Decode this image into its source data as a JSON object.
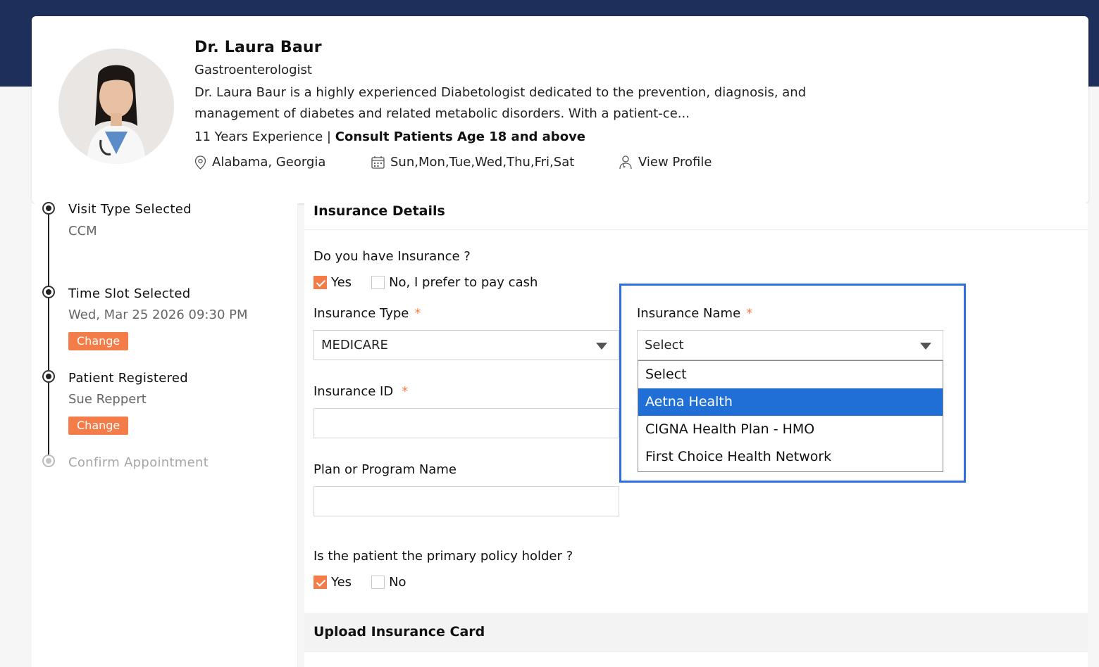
{
  "doctor": {
    "name": "Dr. Laura Baur",
    "specialty": "Gastroenterologist",
    "description": "Dr. Laura Baur is a highly experienced Diabetologist dedicated to the prevention, diagnosis, and management of diabetes and related metabolic disorders. With a patient-ce...",
    "experience": "11 Years Experience |",
    "consult": "Consult Patients Age 18 and above",
    "location": "Alabama, Georgia",
    "days": "Sun,Mon,Tue,Wed,Thu,Fri,Sat",
    "view_profile": "View Profile"
  },
  "timeline": [
    {
      "title": "Visit Type Selected",
      "sub": "CCM"
    },
    {
      "title": "Time Slot Selected",
      "sub": "Wed, Mar 25 2026 09:30 PM",
      "action": "Change"
    },
    {
      "title": "Patient Registered",
      "sub": "Sue Reppert",
      "action": "Change"
    },
    {
      "title": "Confirm Appointment"
    }
  ],
  "insurance": {
    "section_title": "Insurance Details",
    "question": "Do you have Insurance ?",
    "yes_label": "Yes",
    "no_label": "No, I prefer to pay cash",
    "type_label": "Insurance Type",
    "type_value": "MEDICARE",
    "name_label": "Insurance Name",
    "name_value": "Select",
    "id_label": "Insurance ID",
    "plan_label": "Plan or Program Name",
    "primary_question": "Is the patient the primary policy holder ?",
    "primary_yes": "Yes",
    "primary_no": "No",
    "required_mark": "*",
    "options": [
      "Select",
      "Aetna Health",
      "CIGNA Health Plan - HMO",
      "First Choice Health Network"
    ]
  },
  "upload": {
    "section_title": "Upload Insurance Card"
  },
  "colors": {
    "accent": "#f47c48",
    "header": "#1f2f5b",
    "selection": "#1f6fd6",
    "focus": "#2f6fdd"
  }
}
